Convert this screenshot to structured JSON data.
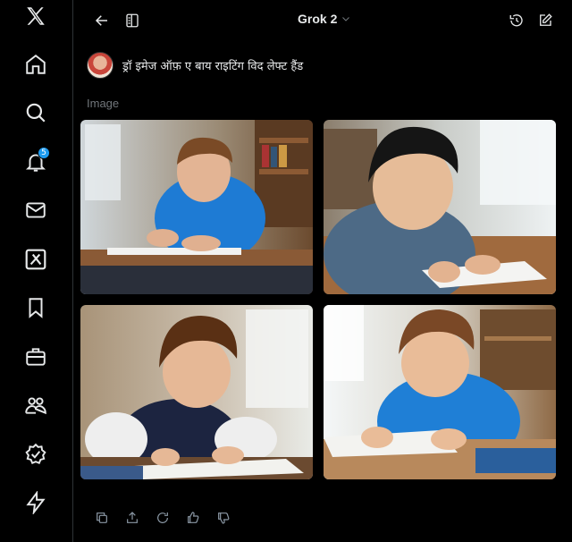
{
  "header": {
    "title": "Grok 2"
  },
  "prompt": {
    "text": "ड्रॉ इमेज ऑफ़ ए बाय राइटिंग विद लेफ्ट हैंड"
  },
  "section_label": "Image",
  "notifications": {
    "count": "5"
  },
  "icons": {
    "sidebar": [
      "x-logo-icon",
      "home-icon",
      "search-icon",
      "notifications-icon",
      "messages-icon",
      "grok-icon",
      "bookmarks-icon",
      "jobs-icon",
      "communities-icon",
      "verified-icon",
      "lightning-icon"
    ],
    "header": [
      "back-arrow-icon",
      "sidebar-toggle-icon",
      "chevron-down-icon",
      "history-icon",
      "new-chat-icon"
    ],
    "actions": [
      "copy-icon",
      "share-icon",
      "regenerate-icon",
      "thumbs-up-icon",
      "thumbs-down-icon"
    ]
  },
  "colors": {
    "background": "#000000",
    "accent": "#1d9bf0",
    "text": "#e7e9ea",
    "muted": "#71767b"
  }
}
